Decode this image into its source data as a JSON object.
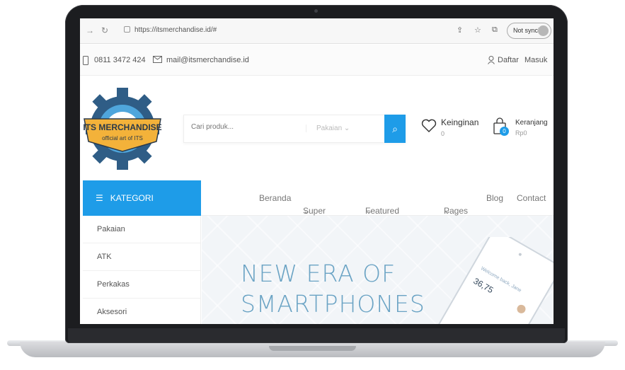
{
  "browser": {
    "url": "https://itsmerchandise.id/#",
    "sync_label": "Not syncing"
  },
  "topbar": {
    "phone": "0811 3472 424",
    "email": "mail@itsmerchandise.id",
    "register": "Daftar",
    "login": "Masuk"
  },
  "logo": {
    "title": "ITS MERCHANDISE",
    "subtitle": "official art of ITS"
  },
  "search": {
    "placeholder": "Cari produk...",
    "category": "Pakaian"
  },
  "wishlist": {
    "label": "Keinginan",
    "count": "0"
  },
  "cart": {
    "label": "Keranjang",
    "total": "Rp0",
    "count": "0"
  },
  "nav": {
    "category_label": "KATEGORI",
    "items": [
      "Beranda",
      "Super Deals",
      "Featured Brands",
      "Pages",
      "Blog",
      "Contact"
    ]
  },
  "sidebar": {
    "items": [
      "Pakaian",
      "ATK",
      "Perkakas",
      "Aksesori"
    ]
  },
  "hero": {
    "line1": "NEW ERA OF",
    "line2": "SMARTPHONES",
    "phone_greeting": "Welcome back, Jane",
    "phone_number": "36,75"
  },
  "colors": {
    "accent": "#1e9ce8",
    "hero_text": "#6aa3c4"
  }
}
